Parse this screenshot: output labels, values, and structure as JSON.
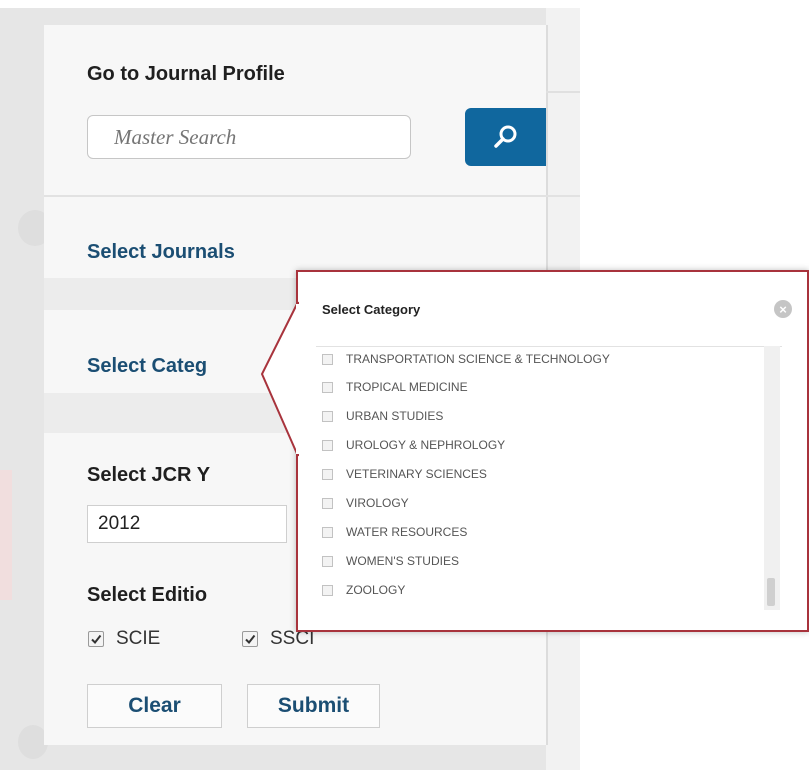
{
  "journal_profile": {
    "title": "Go to Journal Profile",
    "search_placeholder": "Master Search"
  },
  "sections": {
    "select_journals": "Select Journals",
    "select_category": "Select Categ",
    "select_jcr_year": "Select JCR Y",
    "select_edition": "Select Editio"
  },
  "jcr_year": {
    "value": "2012"
  },
  "editions": [
    {
      "label": "SCIE",
      "checked": true
    },
    {
      "label": "SSCI",
      "checked": true
    }
  ],
  "buttons": {
    "clear": "Clear",
    "submit": "Submit"
  },
  "category_popup": {
    "title": "Select Category",
    "items": [
      "TRANSPORTATION SCIENCE & TECHNOLOGY",
      "TROPICAL MEDICINE",
      "URBAN STUDIES",
      "UROLOGY & NEPHROLOGY",
      "VETERINARY SCIENCES",
      "VIROLOGY",
      "WATER RESOURCES",
      "WOMEN'S STUDIES",
      "ZOOLOGY"
    ]
  },
  "colors": {
    "link": "#1b4e73",
    "search_button": "#10679e",
    "popup_border": "#a8333c"
  },
  "icons": {
    "search": "magnifier-icon",
    "close": "close-icon",
    "checkbox": "checkmark-icon"
  }
}
